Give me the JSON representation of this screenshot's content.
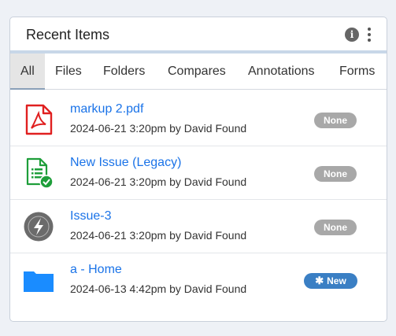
{
  "panel": {
    "title": "Recent Items",
    "info_icon": "info-icon",
    "menu_icon": "kebab-menu-icon"
  },
  "tabs": [
    {
      "label": "All",
      "active": true
    },
    {
      "label": "Files"
    },
    {
      "label": "Folders"
    },
    {
      "label": "Compares"
    },
    {
      "label": "Annotations"
    },
    {
      "label": "Forms"
    }
  ],
  "items": [
    {
      "title": "markup 2.pdf",
      "meta": "2024-06-21 3:20pm by David Found",
      "badge": "None",
      "icon": "pdf-file-icon"
    },
    {
      "title": "New Issue (Legacy)",
      "meta": "2024-06-21 3:20pm by David Found",
      "badge": "None",
      "icon": "issue-form-icon"
    },
    {
      "title": "Issue-3",
      "meta": "2024-06-21 3:20pm by David Found",
      "badge": "None",
      "icon": "lightning-icon"
    },
    {
      "title": "a - Home",
      "meta": "2024-06-13 4:42pm by David Found",
      "badge": "New",
      "icon": "folder-icon"
    }
  ],
  "colors": {
    "link": "#1a73e8",
    "badge_none": "#a8a8a8",
    "badge_new": "#3a7fc4",
    "pdf_red": "#e02020",
    "form_green": "#1e9e3a",
    "folder_blue": "#1a8cff"
  }
}
